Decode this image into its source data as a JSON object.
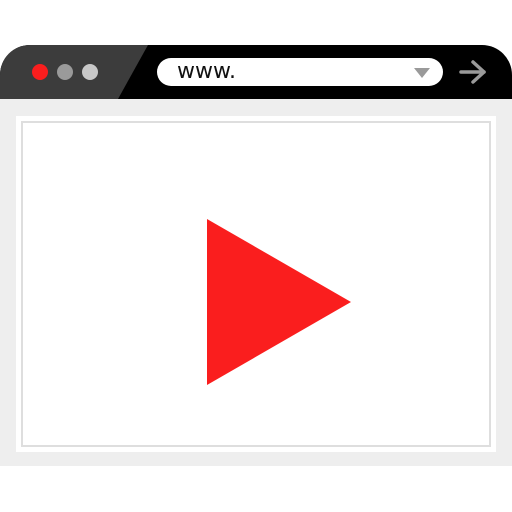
{
  "window": {
    "controls": [
      "close-dot",
      "minimize-dot",
      "maximize-dot"
    ]
  },
  "address_bar": {
    "value": "www.",
    "dropdown_icon": "chevron-down-icon",
    "go_icon": "arrow-right-icon"
  },
  "content": {
    "media": "play-icon"
  },
  "colors": {
    "titlebar": "#000000",
    "titlebar_accent": "#3c3c3c",
    "close": "#fa1e1e",
    "minimize": "#9a9a9a",
    "maximize": "#c8c8c8",
    "frame": "#eeeeee",
    "play": "#fa1e1e"
  }
}
